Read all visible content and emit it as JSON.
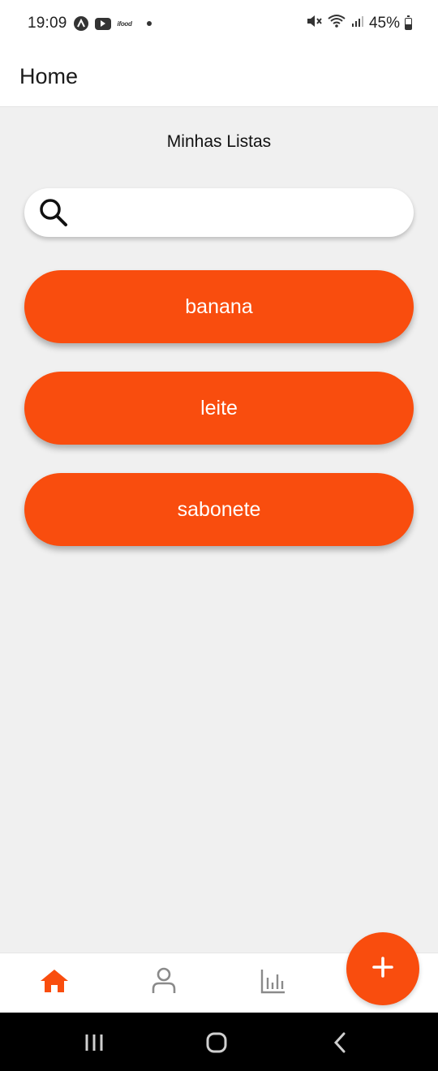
{
  "status_bar": {
    "time": "19:09",
    "notification_icons": [
      "app-a-icon",
      "youtube-icon",
      "ifood-icon",
      "dot-icon"
    ],
    "ifood_label": "ifood",
    "right_icons": [
      "mute-icon",
      "wifi-icon",
      "signal-icon",
      "battery-icon"
    ],
    "battery": "45%",
    "battery_level": 0.45
  },
  "app_bar": {
    "title": "Home"
  },
  "main": {
    "section_title": "Minhas Listas",
    "search": {
      "placeholder": "",
      "value": "",
      "icon": "search-icon"
    },
    "lists": [
      {
        "label": "banana"
      },
      {
        "label": "leite"
      },
      {
        "label": "sabonete"
      }
    ]
  },
  "bottom_nav": {
    "items": [
      {
        "icon": "home-icon",
        "active": true
      },
      {
        "icon": "person-icon",
        "active": false
      },
      {
        "icon": "bar-chart-icon",
        "active": false
      }
    ],
    "fab_icon": "plus-icon"
  },
  "system_nav": {
    "buttons": [
      "recent-apps-icon",
      "home-circle-icon",
      "back-icon"
    ]
  },
  "colors": {
    "accent": "#f94d0e",
    "background": "#f0f0f0",
    "surface": "#ffffff",
    "inactive_icon": "#8a8a8a"
  }
}
